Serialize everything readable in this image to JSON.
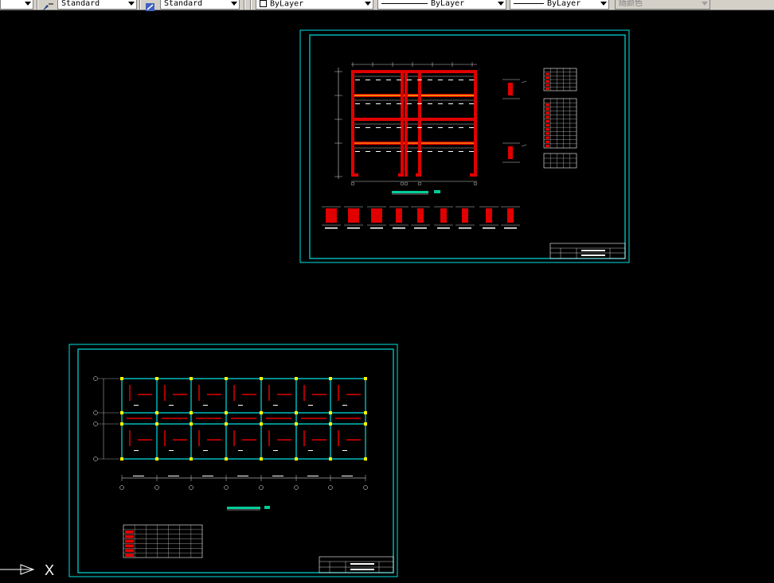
{
  "toolbar": {
    "text_style": "Standard",
    "dim_style": "Standard",
    "layer_color": "ByLayer",
    "linetype": "ByLayer",
    "lineweight": "ByLayer",
    "plot_style": "随颜色"
  },
  "colors": {
    "background": "#000000",
    "frame": "#00e0e0",
    "concrete": "#e00000",
    "dimension": "#ffffff",
    "highlight": "#ffff00",
    "title_bar": "#00cc99"
  },
  "ucs_icon": {
    "axis_label": "X"
  }
}
